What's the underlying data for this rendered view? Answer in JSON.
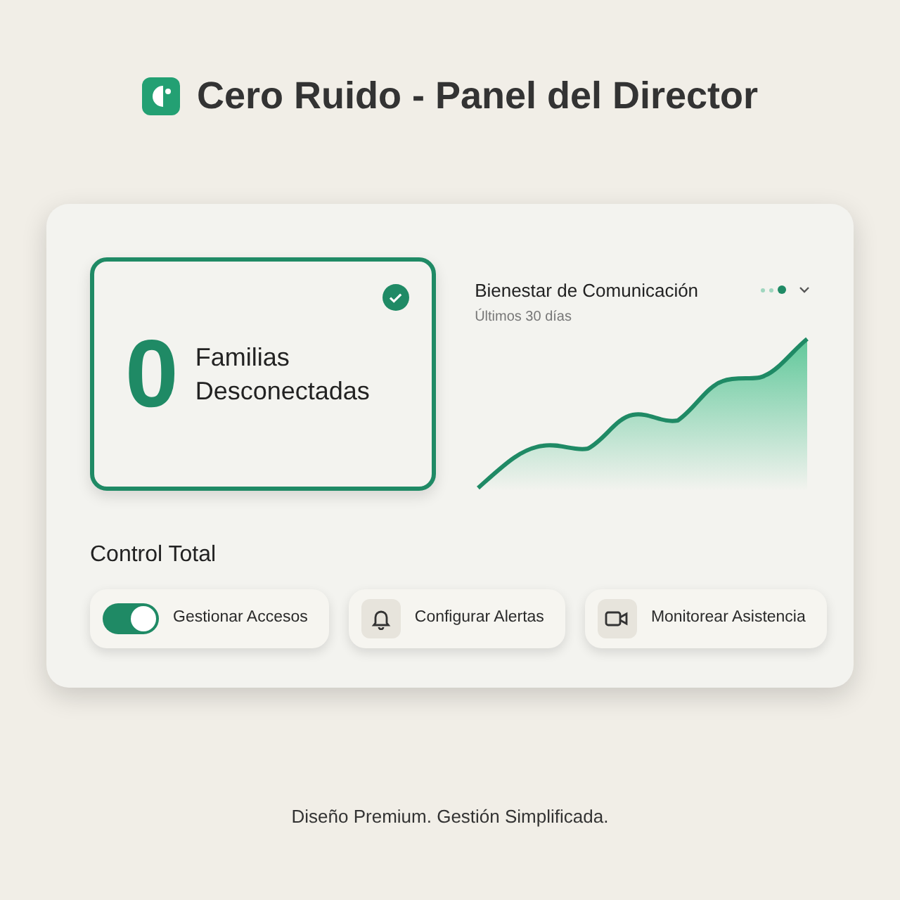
{
  "header": {
    "title": "Cero Ruido - Panel del Director"
  },
  "stat_card": {
    "value": "0",
    "label_line_1": "Familias",
    "label_line_2": "Desconectadas",
    "checked": true
  },
  "trend": {
    "title": "Bienestar de Comunicación",
    "subtitle": "Últimos 30 días",
    "dots": [
      {
        "selected": false
      },
      {
        "selected": false
      },
      {
        "selected": true
      }
    ]
  },
  "controls": {
    "title": "Control Total",
    "items": [
      {
        "kind": "toggle",
        "label": "Gestionar Accesos",
        "on": true
      },
      {
        "kind": "bell",
        "label": "Configurar Alertas"
      },
      {
        "kind": "video",
        "label": "Monitorear Asistencia"
      }
    ]
  },
  "footer": "Diseño Premium. Gestión Simplificada."
}
